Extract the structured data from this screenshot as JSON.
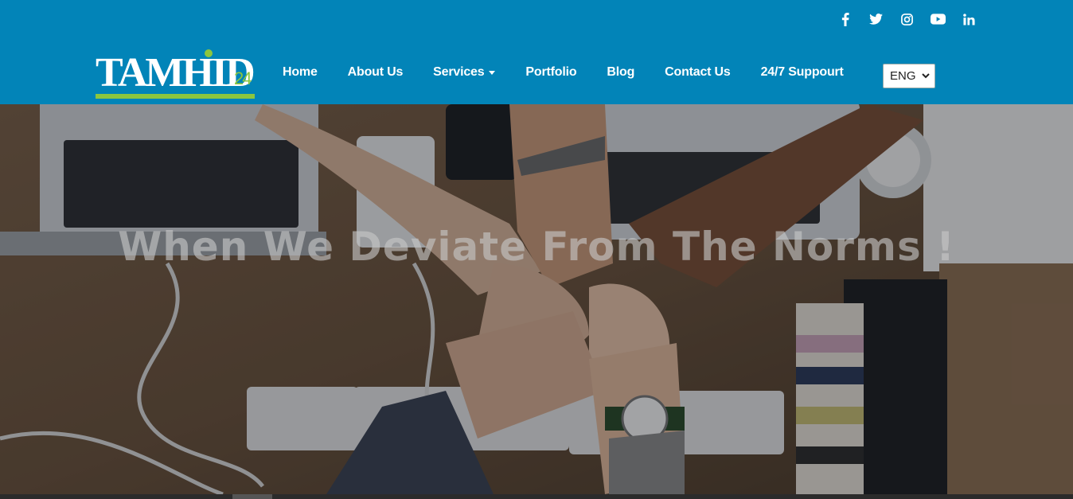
{
  "social": {
    "icons": [
      "facebook-icon",
      "twitter-icon",
      "instagram-icon",
      "youtube-icon",
      "linkedin-icon"
    ],
    "color": "#ffffff"
  },
  "brand": {
    "logo_text": "TAMHID",
    "logo_suffix": "24",
    "accent": "#8cc63f",
    "header_bg": "#0284b8"
  },
  "nav": {
    "items": [
      {
        "label": "Home"
      },
      {
        "label": "About Us"
      },
      {
        "label": "Services"
      },
      {
        "label": "Portfolio"
      },
      {
        "label": "Blog"
      },
      {
        "label": "Contact Us"
      },
      {
        "label": "24/7 Suppourt"
      }
    ]
  },
  "language": {
    "selected": "ENG"
  },
  "hero": {
    "title": "When We Deviate From The Norms !"
  }
}
